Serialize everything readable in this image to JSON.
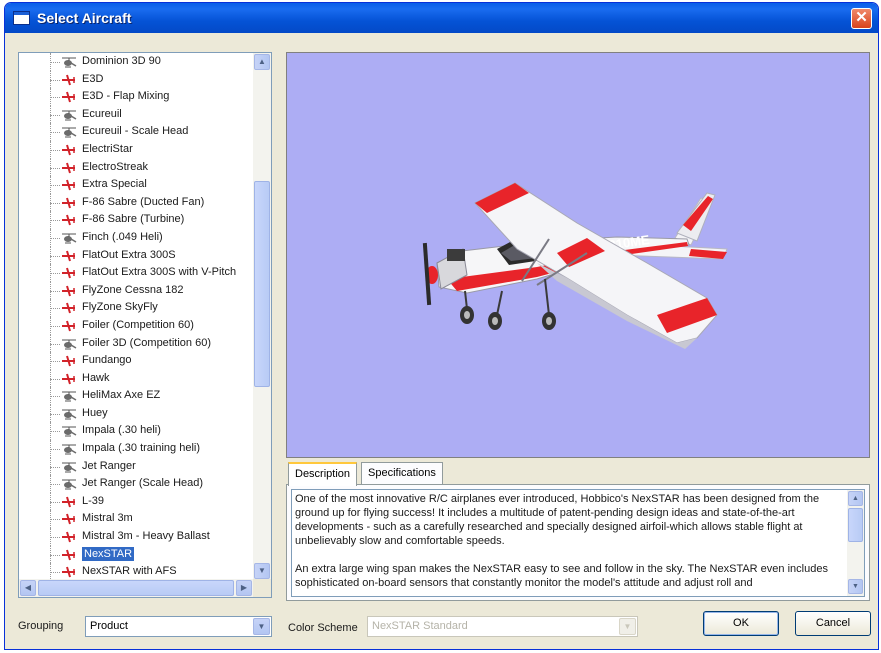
{
  "window": {
    "title": "Select Aircraft",
    "close_label": "✕"
  },
  "aircraft_list": {
    "items": [
      {
        "label": "Dominion 3D 90",
        "icon": "helicopter-icon"
      },
      {
        "label": "E3D",
        "icon": "airplane-icon"
      },
      {
        "label": "E3D - Flap Mixing",
        "icon": "airplane-icon"
      },
      {
        "label": "Ecureuil",
        "icon": "helicopter-icon"
      },
      {
        "label": "Ecureuil - Scale Head",
        "icon": "helicopter-icon"
      },
      {
        "label": "ElectriStar",
        "icon": "airplane-icon"
      },
      {
        "label": "ElectroStreak",
        "icon": "airplane-icon"
      },
      {
        "label": "Extra Special",
        "icon": "airplane-icon"
      },
      {
        "label": "F-86 Sabre (Ducted Fan)",
        "icon": "airplane-icon"
      },
      {
        "label": "F-86 Sabre (Turbine)",
        "icon": "airplane-icon"
      },
      {
        "label": "Finch (.049 Heli)",
        "icon": "helicopter-icon"
      },
      {
        "label": "FlatOut Extra 300S",
        "icon": "airplane-icon"
      },
      {
        "label": "FlatOut Extra 300S with V-Pitch",
        "icon": "airplane-icon"
      },
      {
        "label": "FlyZone Cessna 182",
        "icon": "airplane-icon"
      },
      {
        "label": "FlyZone SkyFly",
        "icon": "airplane-icon"
      },
      {
        "label": "Foiler (Competition 60)",
        "icon": "airplane-icon"
      },
      {
        "label": "Foiler 3D (Competition 60)",
        "icon": "helicopter-icon"
      },
      {
        "label": "Fundango",
        "icon": "airplane-icon"
      },
      {
        "label": "Hawk",
        "icon": "airplane-icon"
      },
      {
        "label": "HeliMax Axe EZ",
        "icon": "helicopter-icon"
      },
      {
        "label": "Huey",
        "icon": "helicopter-icon"
      },
      {
        "label": "Impala (.30 heli)",
        "icon": "helicopter-icon"
      },
      {
        "label": "Impala (.30 training heli)",
        "icon": "helicopter-icon"
      },
      {
        "label": "Jet Ranger",
        "icon": "helicopter-icon"
      },
      {
        "label": "Jet Ranger (Scale Head)",
        "icon": "helicopter-icon"
      },
      {
        "label": "L-39",
        "icon": "airplane-icon"
      },
      {
        "label": "Mistral 3m",
        "icon": "airplane-icon"
      },
      {
        "label": "Mistral 3m - Heavy Ballast",
        "icon": "airplane-icon"
      },
      {
        "label": "NexSTAR",
        "icon": "airplane-icon",
        "selected": true
      },
      {
        "label": "NexSTAR with AFS",
        "icon": "airplane-icon"
      }
    ],
    "selected_index": 28
  },
  "preview": {
    "aircraft_registration": "N310ME",
    "background_color": "#adadf4"
  },
  "tabs": [
    {
      "label": "Description",
      "active": true
    },
    {
      "label": "Specifications",
      "active": false
    }
  ],
  "description": {
    "paragraphs": [
      "One of the most innovative R/C airplanes ever introduced, Hobbico's NexSTAR has been designed from the ground up for flying success! It includes a multitude of patent-pending design ideas and state-of-the-art developments - such as a carefully researched and specially designed airfoil-which allows stable flight at unbelievably slow and comfortable speeds.",
      "An extra large wing span makes the NexSTAR easy to see and follow in the sky. The NexSTAR even includes sophisticated on-board sensors that constantly monitor the model's attitude and adjust roll and"
    ]
  },
  "grouping": {
    "label": "Grouping",
    "value": "Product"
  },
  "color_scheme": {
    "label": "Color Scheme",
    "value": "NexSTAR Standard",
    "enabled": false
  },
  "buttons": {
    "ok": "OK",
    "cancel": "Cancel"
  },
  "colors": {
    "accent": "#316ac5",
    "titlebar": "#0553d6",
    "plane_red": "#e8242a"
  }
}
